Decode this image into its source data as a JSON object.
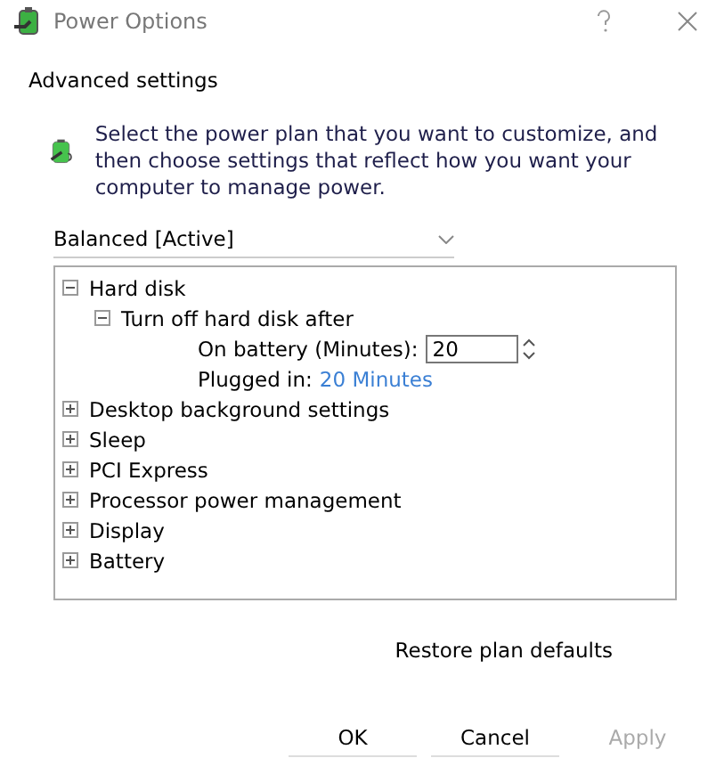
{
  "window": {
    "title": "Power Options"
  },
  "page_title": "Advanced settings",
  "intro": "Select the power plan that you want to customize, and then choose settings that reflect how you want your computer to manage power.",
  "plan_dropdown": {
    "value": "Balanced [Active]"
  },
  "tree": [
    {
      "label": "Hard disk",
      "expanded": true,
      "children": [
        {
          "label": "Turn off hard disk after",
          "expanded": true,
          "settings": [
            {
              "kind": "spin",
              "label": "On battery (Minutes):",
              "value": "20"
            },
            {
              "kind": "link",
              "label": "Plugged in:",
              "value": "20 Minutes"
            }
          ]
        }
      ]
    },
    {
      "label": "Desktop background settings",
      "expanded": false
    },
    {
      "label": "Sleep",
      "expanded": false
    },
    {
      "label": "PCI Express",
      "expanded": false
    },
    {
      "label": "Processor power management",
      "expanded": false
    },
    {
      "label": "Display",
      "expanded": false
    },
    {
      "label": "Battery",
      "expanded": false
    }
  ],
  "restore_button": "Restore plan defaults",
  "buttons": [
    {
      "label": "OK",
      "disabled": false
    },
    {
      "label": "Cancel",
      "disabled": false
    },
    {
      "label": "Apply",
      "disabled": true
    }
  ]
}
